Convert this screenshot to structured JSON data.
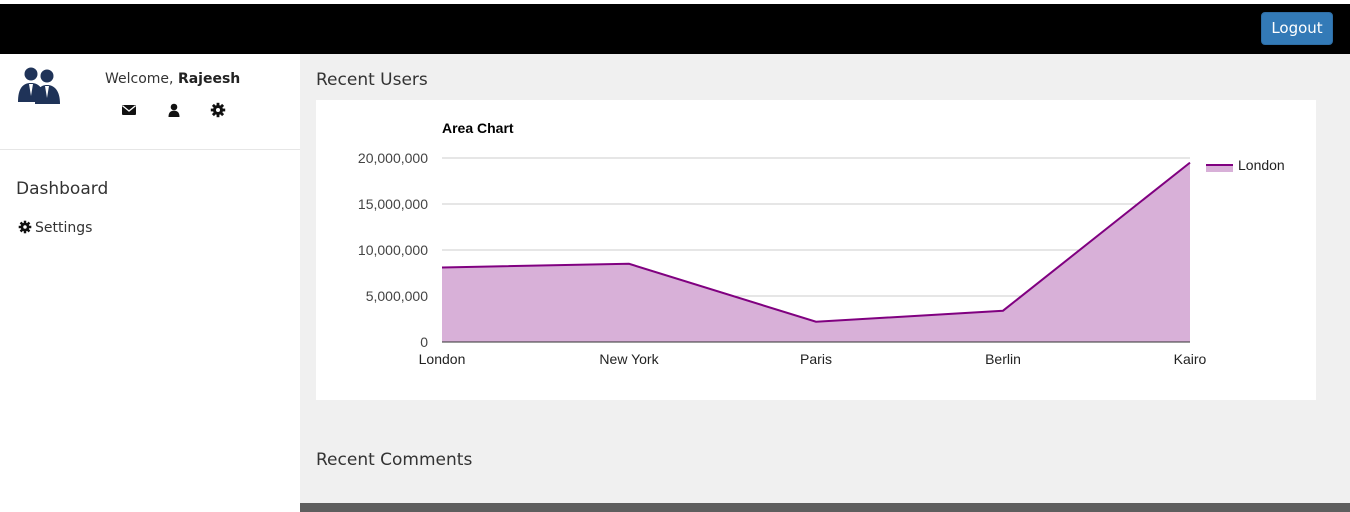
{
  "header": {
    "logout_label": "Logout"
  },
  "sidebar": {
    "welcome_prefix": "Welcome,",
    "user_name": "Rajeesh",
    "quick_icons": [
      "envelope-icon",
      "user-icon",
      "gear-icon"
    ],
    "nav_title": "Dashboard",
    "nav_items": [
      {
        "label": "Settings",
        "icon": "gear-icon"
      }
    ]
  },
  "main": {
    "recent_users_title": "Recent Users",
    "recent_comments_title": "Recent Comments"
  },
  "chart_data": {
    "type": "area",
    "title": "Area Chart",
    "categories": [
      "London",
      "New York",
      "Paris",
      "Berlin",
      "Kairo"
    ],
    "series": [
      {
        "name": "London",
        "values": [
          8100000,
          8500000,
          2200000,
          3400000,
          19500000
        ]
      }
    ],
    "ylim": [
      0,
      20000000
    ],
    "yticks": [
      0,
      5000000,
      10000000,
      15000000,
      20000000
    ],
    "ytick_labels": [
      "0",
      "5,000,000",
      "10,000,000",
      "15,000,000",
      "20,000,000"
    ],
    "grid": true,
    "legend": "right",
    "colors": {
      "line": "#800080",
      "fill": "#d8b0d8"
    }
  },
  "colors": {
    "topbar": "#000000",
    "logout_button": "#337ab7",
    "main_background": "#f0f0f0"
  }
}
